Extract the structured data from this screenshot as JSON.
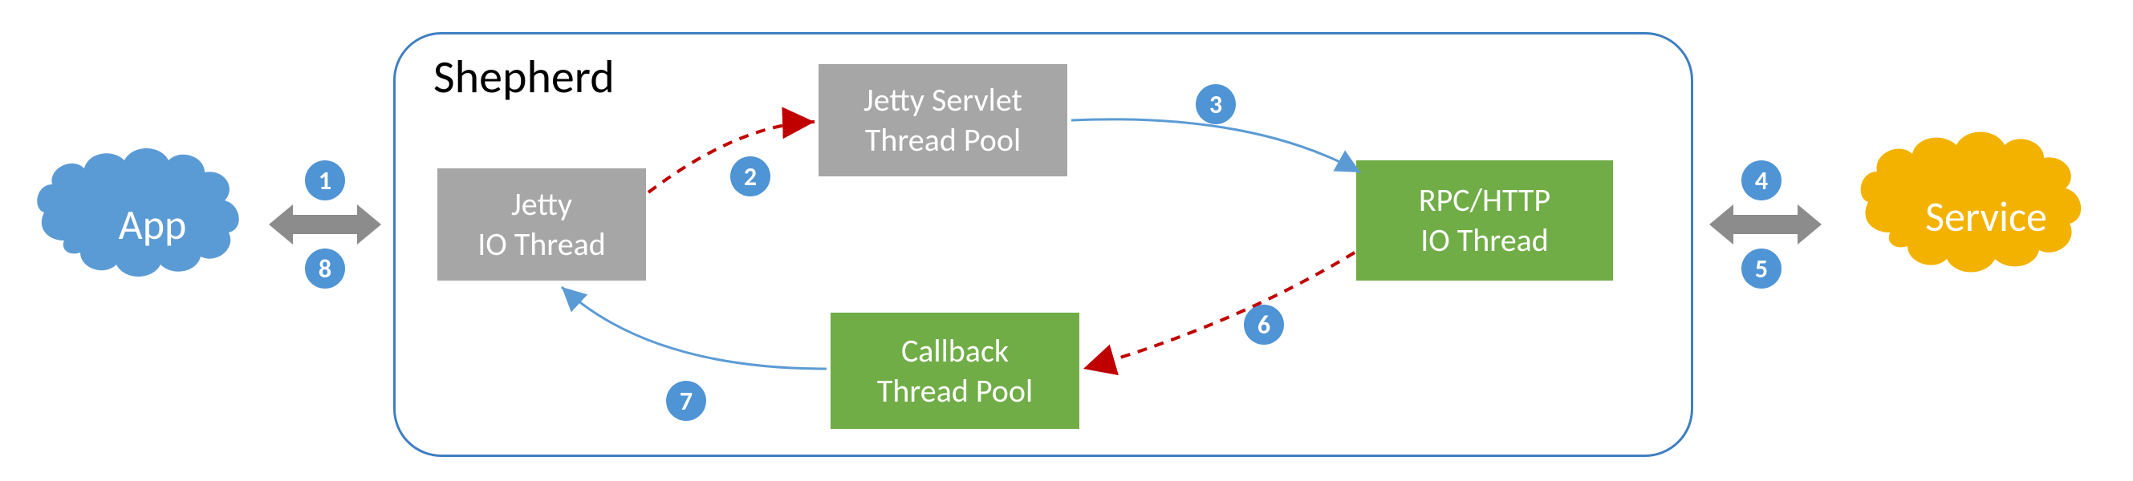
{
  "diagram": {
    "title": "Shepherd",
    "left_node": {
      "label": "App",
      "color": "#5B9BD5"
    },
    "right_node": {
      "label": "Service",
      "color": "#F3B200"
    },
    "boxes": {
      "jetty_io": {
        "line1": "Jetty",
        "line2": "IO Thread",
        "color": "gray"
      },
      "jetty_servlet": {
        "line1": "Jetty Servlet",
        "line2": "Thread Pool",
        "color": "gray"
      },
      "rpc": {
        "line1": "RPC/HTTP",
        "line2": "IO Thread",
        "color": "green"
      },
      "callback": {
        "line1": "Callback",
        "line2": "Thread Pool",
        "color": "green"
      }
    },
    "steps": {
      "s1": "1",
      "s2": "2",
      "s3": "3",
      "s4": "4",
      "s5": "5",
      "s6": "6",
      "s7": "7",
      "s8": "8"
    },
    "edges": [
      {
        "from": "App",
        "to": "Jetty IO Thread",
        "step": 1,
        "style": "bidirectional-gray"
      },
      {
        "from": "Jetty IO Thread",
        "to": "Jetty Servlet Thread Pool",
        "step": 2,
        "style": "dashed-red"
      },
      {
        "from": "Jetty Servlet Thread Pool",
        "to": "RPC/HTTP IO Thread",
        "step": 3,
        "style": "solid-blue"
      },
      {
        "from": "RPC/HTTP IO Thread",
        "to": "Service",
        "step": 4,
        "style": "bidirectional-gray"
      },
      {
        "from": "Service",
        "to": "RPC/HTTP IO Thread",
        "step": 5,
        "style": "bidirectional-gray"
      },
      {
        "from": "RPC/HTTP IO Thread",
        "to": "Callback Thread Pool",
        "step": 6,
        "style": "dashed-red"
      },
      {
        "from": "Callback Thread Pool",
        "to": "Jetty IO Thread",
        "step": 7,
        "style": "solid-blue"
      },
      {
        "from": "Jetty IO Thread",
        "to": "App",
        "step": 8,
        "style": "bidirectional-gray"
      }
    ],
    "colors": {
      "blue": "#5B9BD5",
      "orange": "#F3B200",
      "gray": "#A6A6A6",
      "green": "#70AD47",
      "arrow_gray": "#8C8C8C",
      "badge": "#4F94D4",
      "dashed_red": "#C00000",
      "border": "#3E7FC1"
    }
  }
}
